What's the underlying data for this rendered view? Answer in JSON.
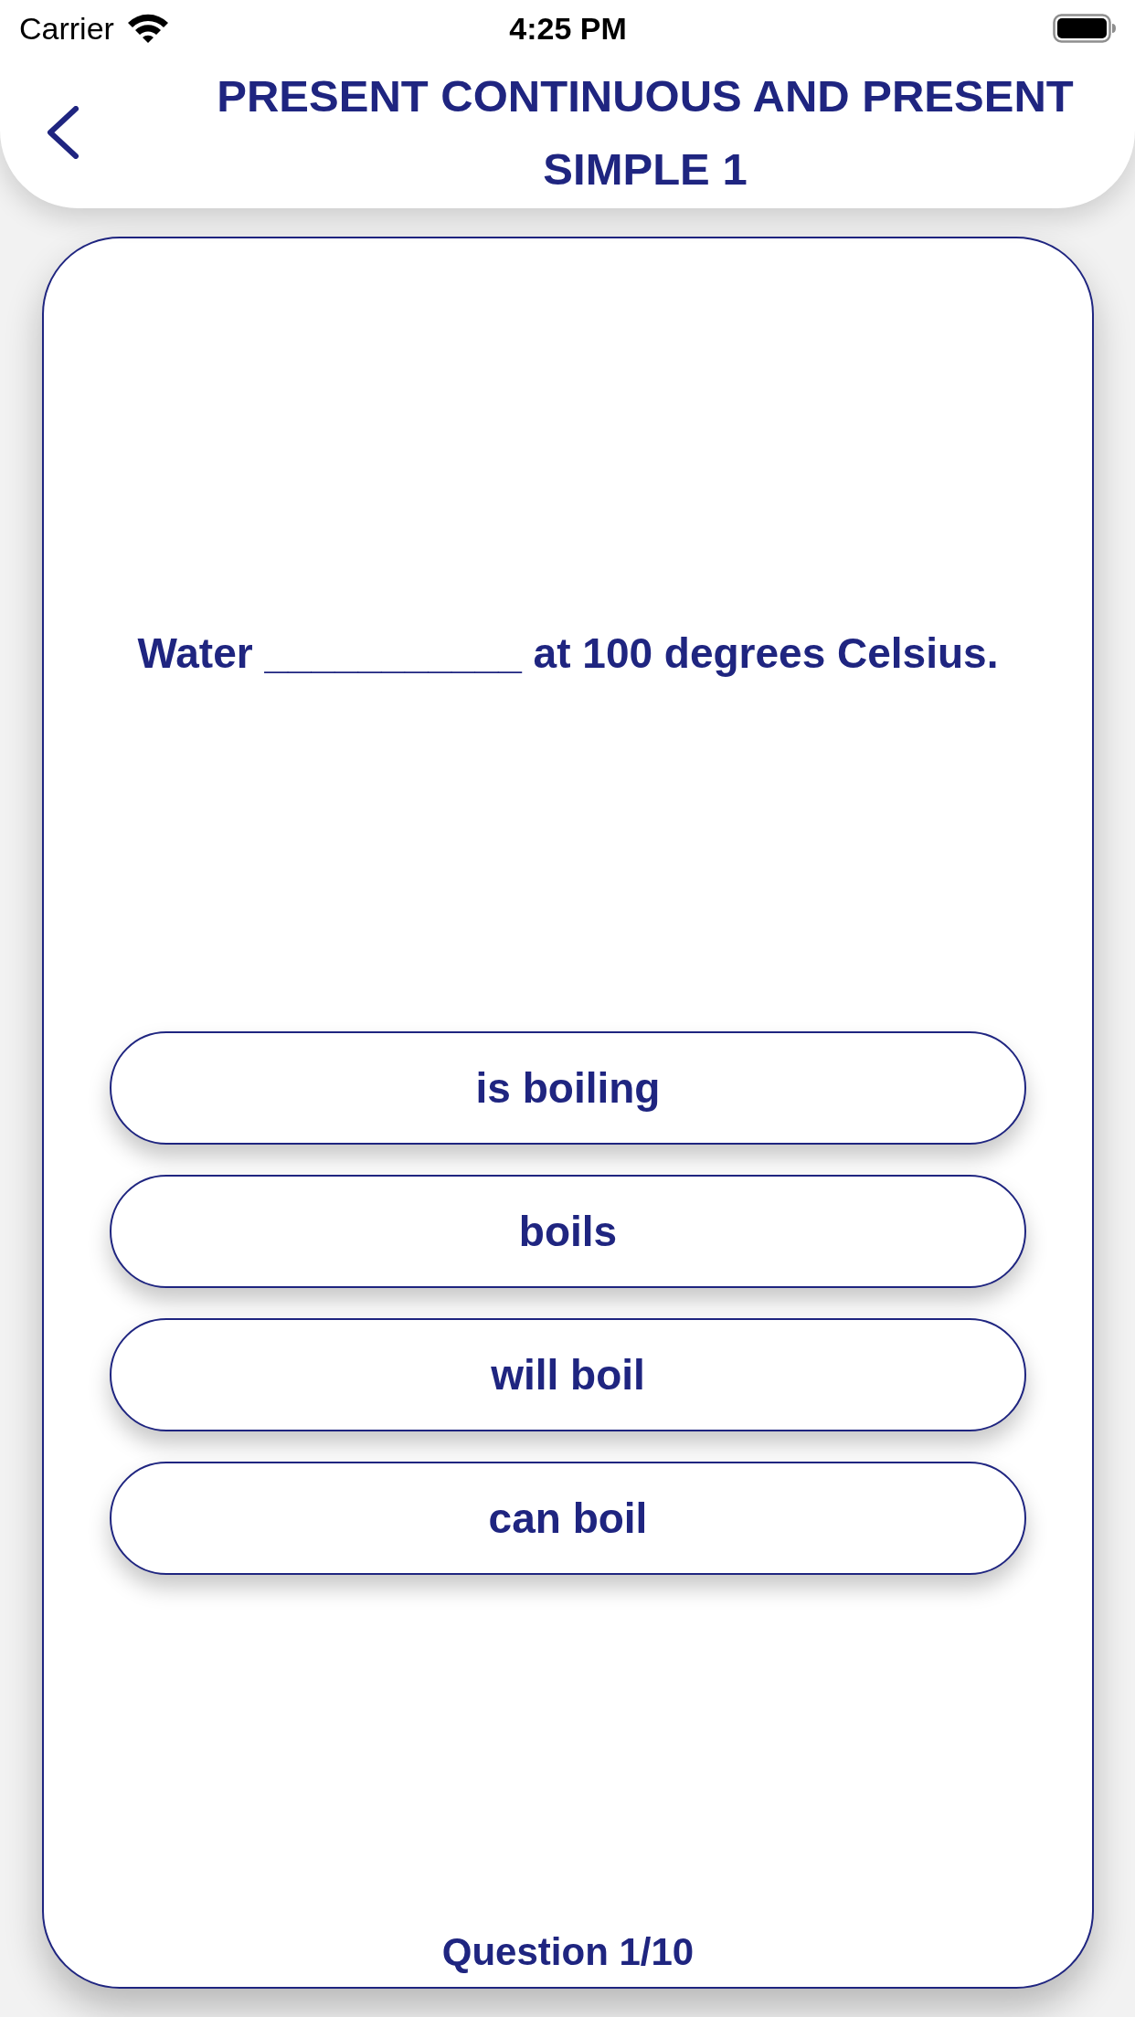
{
  "status_bar": {
    "carrier": "Carrier",
    "time": "4:25 PM"
  },
  "header": {
    "title": "PRESENT CONTINUOUS AND PRESENT SIMPLE 1"
  },
  "question": {
    "text": "Water ___________ at 100 degrees Celsius."
  },
  "options": [
    {
      "label": "is boiling",
      "selected": false
    },
    {
      "label": "boils",
      "selected": false
    },
    {
      "label": "will boil",
      "selected": false
    },
    {
      "label": "can boil",
      "selected": false
    }
  ],
  "progress": "Question 1/10"
}
